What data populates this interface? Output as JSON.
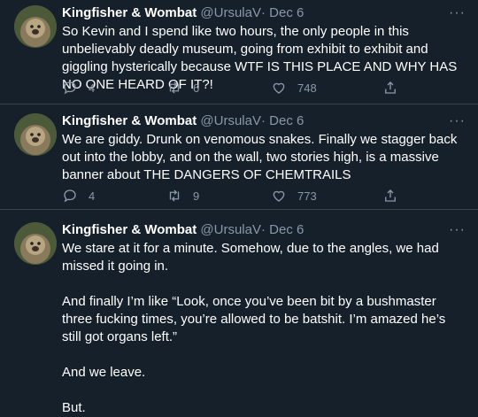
{
  "author": {
    "name": "Kingfisher & Wombat",
    "handle": "@UrsulaV",
    "separator": "·",
    "date": "Dec 6"
  },
  "more_label": "···",
  "tweets": [
    {
      "lines": [
        "So Kevin and I spend like two hours, the only people in this unbelievably deadly museum, going from exhibit to exhibit and giggling hysterically because WTF IS THIS PLACE AND WHY HAS NO ONE HEARD OF IT?!"
      ],
      "replies": "4",
      "retweets": "6",
      "likes": "748"
    },
    {
      "lines": [
        "We are giddy. Drunk on venomous snakes. Finally we stagger back out into the lobby, and on the wall, two stories high, is a massive banner about THE DANGERS OF CHEMTRAILS"
      ],
      "replies": "4",
      "retweets": "9",
      "likes": "773"
    },
    {
      "lines": [
        "We stare at it for a minute. Somehow, due to the angles, we had missed it going in.",
        "And finally I’m like “Look, once you’ve been bit by a bushmaster three fucking times, you’re allowed to be batshit. I’m amazed he’s still got organs left.”",
        "And we leave.",
        "But."
      ]
    }
  ],
  "colors": {
    "background": "#15202b",
    "text": "#ffffff",
    "muted": "#8b98a5",
    "divider": "#38444d"
  }
}
